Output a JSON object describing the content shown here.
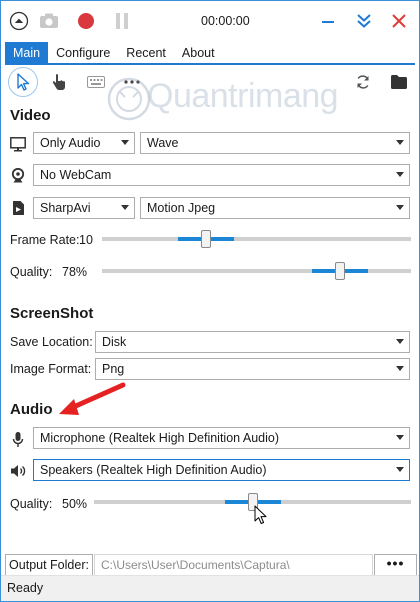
{
  "titlebar": {
    "timer": "00:00:00"
  },
  "tabs": [
    {
      "label": "Main",
      "active": true
    },
    {
      "label": "Configure"
    },
    {
      "label": "Recent"
    },
    {
      "label": "About"
    }
  ],
  "watermark": "Quantrimang",
  "video": {
    "title": "Video",
    "source": "Only Audio",
    "source_mode": "Wave",
    "webcam": "No WebCam",
    "encoder": "SharpAvi",
    "codec": "Motion Jpeg",
    "frame_rate_label": "Frame Rate:",
    "frame_rate_value": "10",
    "frame_rate_level": 0.33,
    "quality_label": "Quality:",
    "quality_value": "78%",
    "quality_level": 0.78
  },
  "screenshot": {
    "title": "ScreenShot",
    "save_location_label": "Save Location:",
    "save_location": "Disk",
    "image_format_label": "Image Format:",
    "image_format": "Png"
  },
  "audio": {
    "title": "Audio",
    "microphone": "Microphone (Realtek High Definition Audio)",
    "speakers": "Speakers (Realtek High Definition Audio)",
    "quality_label": "Quality:",
    "quality_value": "50%",
    "quality_level": 0.5
  },
  "output": {
    "label": "Output Folder:",
    "path": "C:\\Users\\User\\Documents\\Captura\\",
    "browse": "•••"
  },
  "status": "Ready",
  "colors": {
    "accent": "#1e7ad2",
    "record": "#d9383f",
    "slider_fill": "#1c86d6",
    "arrow": "#e52222"
  }
}
